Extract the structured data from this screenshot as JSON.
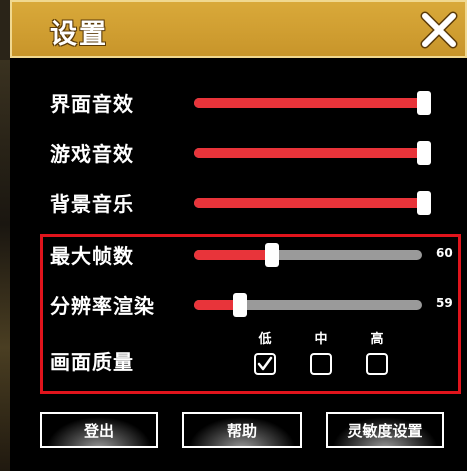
{
  "header": {
    "title": "设置"
  },
  "sliders": [
    {
      "label": "界面音效",
      "value_fraction": 1.0
    },
    {
      "label": "游戏音效",
      "value_fraction": 1.0
    },
    {
      "label": "背景音乐",
      "value_fraction": 1.0
    },
    {
      "label": "最大帧数",
      "value_fraction": 0.34,
      "value_text": "60"
    },
    {
      "label": "分辨率渲染",
      "value_fraction": 0.2,
      "value_text": "59"
    }
  ],
  "quality": {
    "label": "画面质量",
    "options": [
      {
        "label": "低",
        "checked": true
      },
      {
        "label": "中",
        "checked": false
      },
      {
        "label": "高",
        "checked": false
      }
    ]
  },
  "buttons": {
    "logout": "登出",
    "help": "帮助",
    "sensitivity": "灵敏度设置"
  },
  "colors": {
    "header": "#c8952a",
    "slider_fill": "#e8343a",
    "slider_track": "#9a9a9a",
    "highlight": "#e0141c"
  }
}
